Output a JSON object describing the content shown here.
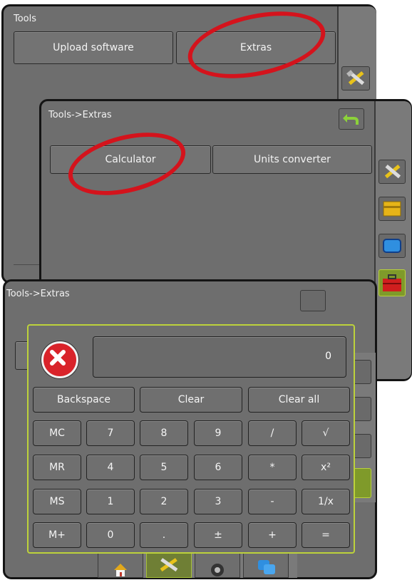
{
  "panel1": {
    "title": "Tools",
    "buttons": [
      "Upload software",
      "Extras"
    ]
  },
  "panel2": {
    "title": "Tools->Extras",
    "buttons": [
      "Calculator",
      "Units converter"
    ]
  },
  "panel3": {
    "title": "Tools->Extras"
  },
  "calculator": {
    "display": "0",
    "top_row": [
      "Backspace",
      "Clear",
      "Clear all"
    ],
    "keys": [
      [
        "MC",
        "7",
        "8",
        "9",
        "/",
        "√"
      ],
      [
        "MR",
        "4",
        "5",
        "6",
        "*",
        "x²"
      ],
      [
        "MS",
        "1",
        "2",
        "3",
        "-",
        "1/x"
      ],
      [
        "M+",
        "0",
        ".",
        "±",
        "+",
        "="
      ]
    ]
  },
  "colors": {
    "highlight": "#d4131c",
    "active_tab": "#a6c037",
    "panel_bg": "#6e6e6e"
  },
  "icons": {
    "tools": "tools-icon",
    "back": "back-arrow-icon",
    "home": "home-icon",
    "close": "close-icon"
  }
}
